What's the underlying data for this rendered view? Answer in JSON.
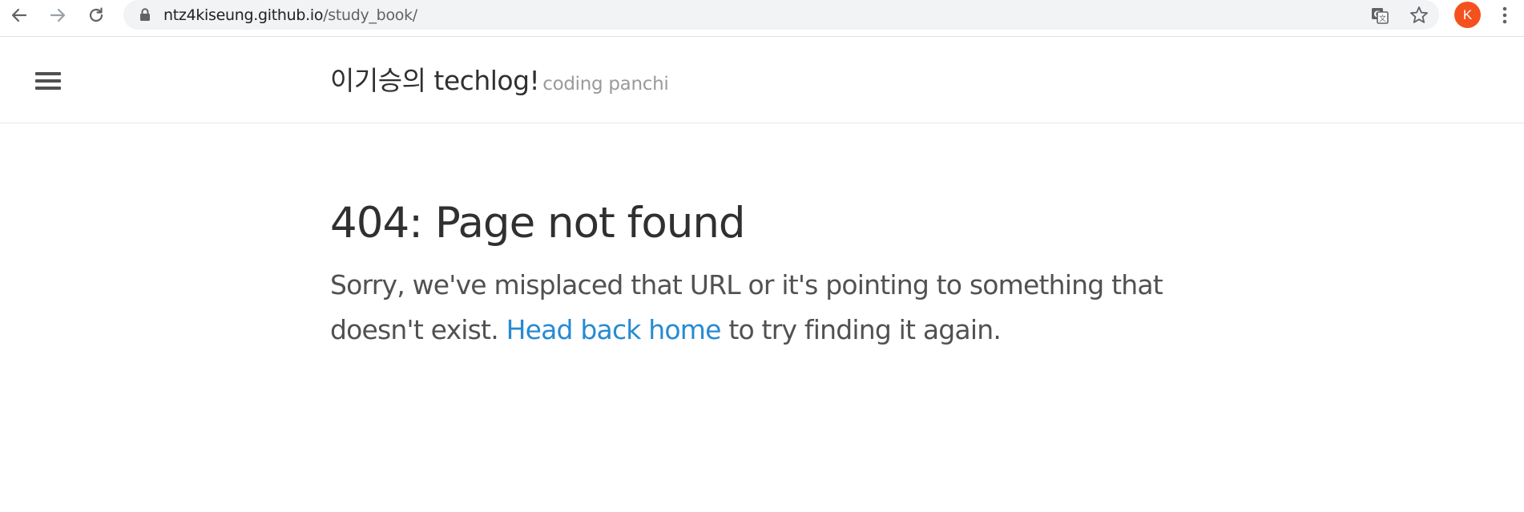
{
  "browser": {
    "url_host": "ntz4kiseung.github.io",
    "url_path": "/study_book/",
    "profile_initial": "K",
    "avatar_color": "#f4511e",
    "icons": {
      "back": "arrow-left-icon",
      "forward": "arrow-right-icon",
      "reload": "reload-icon",
      "lock": "lock-icon",
      "translate": "translate-icon",
      "bookmark": "star-icon",
      "menu": "kebab-menu-icon"
    }
  },
  "header": {
    "menu_icon": "hamburger-icon",
    "title": "이기승의 techlog!",
    "tagline": "coding panchi"
  },
  "main": {
    "heading": "404: Page not found",
    "message_before": "Sorry, we've misplaced that URL or it's pointing to something that doesn't exist.",
    "link_text": "Head back home",
    "message_after": "to try finding it again."
  },
  "colors": {
    "link": "#268bd2",
    "heading_text": "#303030",
    "body_text": "#515151",
    "tagline": "#9a9a9a"
  }
}
